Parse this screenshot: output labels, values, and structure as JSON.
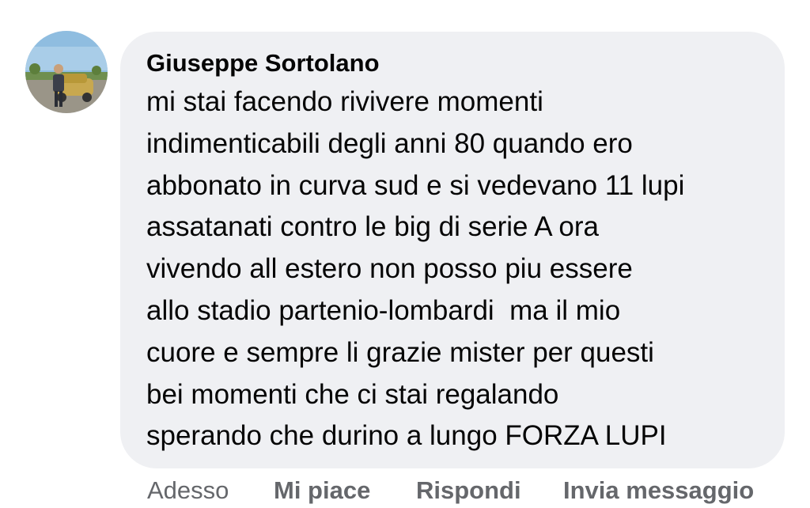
{
  "comment": {
    "author": "Giuseppe Sortolano",
    "text_lines": [
      "mi stai facendo rivivere momenti",
      "indimenticabili degli anni 80 quando ero",
      "abbonato in curva sud e si vedevano 11 lupi",
      "assatanati contro le big di serie A ora",
      "vivendo all estero non posso piu essere",
      "allo stadio partenio-lombardi  ma il mio",
      "cuore e sempre li grazie mister per questi",
      "bei momenti che ci stai regalando",
      "sperando che durino a lungo FORZA LUPI"
    ]
  },
  "actions": {
    "time": "Adesso",
    "like": "Mi piace",
    "reply": "Rispondi",
    "message": "Invia messaggio"
  },
  "colors": {
    "bubble_bg": "#eff0f3",
    "text": "#050505",
    "secondary_text": "#65676b"
  }
}
